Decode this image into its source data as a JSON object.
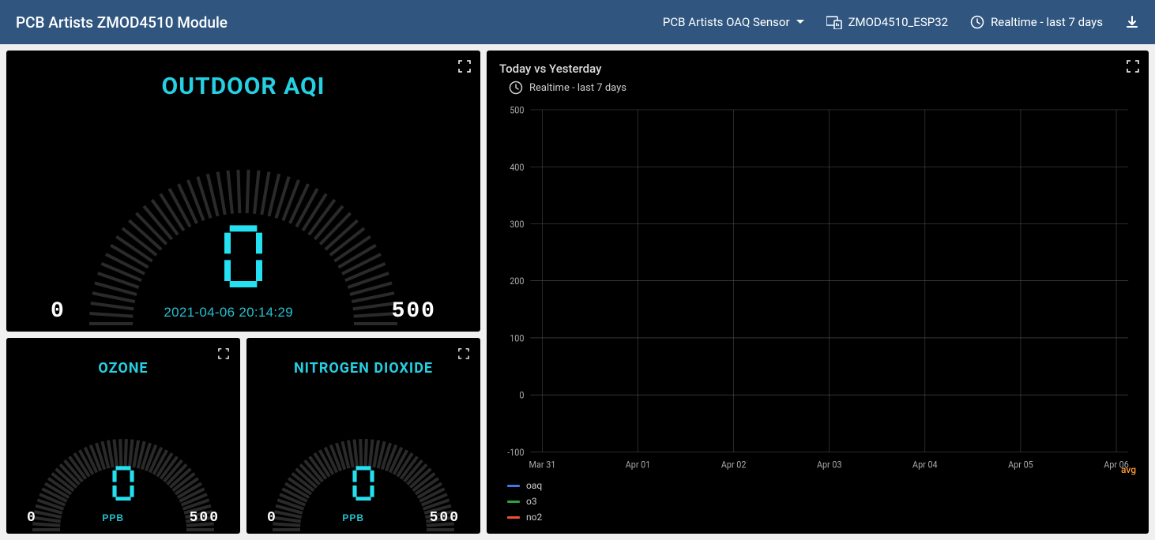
{
  "header": {
    "title": "PCB Artists ZMOD4510 Module",
    "sensor_dropdown": "PCB Artists OAQ Sensor",
    "device": "ZMOD4510_ESP32",
    "timerange": "Realtime - last 7 days"
  },
  "gauges": {
    "main": {
      "title": "OUTDOOR AQI",
      "value": "0",
      "min": "0",
      "max": "500",
      "timestamp": "2021-04-06 20:14:29"
    },
    "ozone": {
      "title": "OZONE",
      "value": "0",
      "min": "0",
      "max": "500",
      "unit": "PPB"
    },
    "no2": {
      "title": "NITROGEN DIOXIDE",
      "value": "0",
      "min": "0",
      "max": "500",
      "unit": "PPB"
    }
  },
  "chart": {
    "title": "Today vs Yesterday",
    "subtitle": "Realtime - last 7 days",
    "avg_label": "avg",
    "legend": [
      {
        "name": "oaq",
        "color": "#3d79e8"
      },
      {
        "name": "o3",
        "color": "#2ea043"
      },
      {
        "name": "no2",
        "color": "#f05030"
      }
    ]
  },
  "chart_data": {
    "type": "line",
    "title": "Today vs Yesterday",
    "xlabel": "",
    "ylabel": "",
    "ylim": [
      -100,
      500
    ],
    "x_categories": [
      "Mar 31",
      "Apr 01",
      "Apr 02",
      "Apr 03",
      "Apr 04",
      "Apr 05",
      "Apr 06"
    ],
    "y_ticks": [
      -100,
      0,
      100,
      200,
      300,
      400,
      500
    ],
    "series": [
      {
        "name": "oaq",
        "color": "#3d79e8",
        "values": []
      },
      {
        "name": "o3",
        "color": "#2ea043",
        "values": []
      },
      {
        "name": "no2",
        "color": "#f05030",
        "values": []
      }
    ]
  }
}
